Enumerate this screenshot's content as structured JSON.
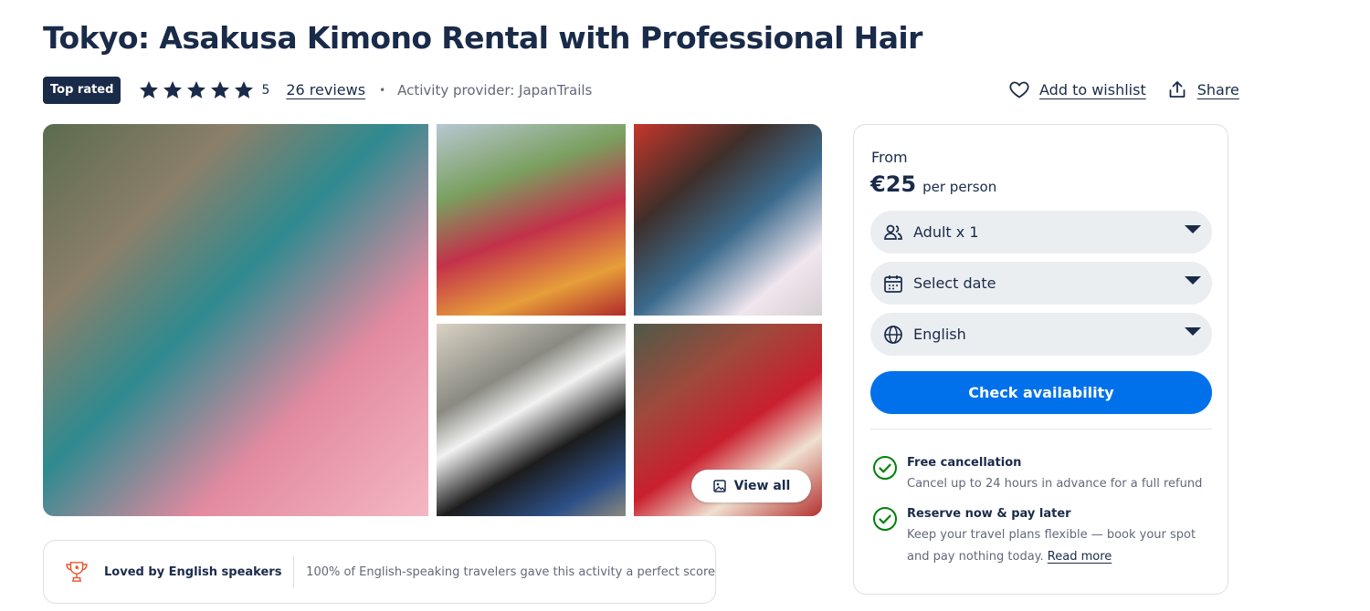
{
  "title": "Tokyo: Asakusa Kimono Rental with Professional Hair",
  "meta": {
    "badge": "Top rated",
    "stars": 5,
    "rating": "5",
    "reviews": "26 reviews",
    "separator": "•",
    "provider": "Activity provider: JapanTrails"
  },
  "actions": {
    "wishlist": "Add to wishlist",
    "share": "Share"
  },
  "gallery": {
    "view_all": "View all"
  },
  "loved": {
    "title": "Loved by English speakers",
    "text": "100% of English-speaking travelers gave this activity a perfect score"
  },
  "booking": {
    "from_label": "From",
    "price": "€25",
    "per": "per person",
    "participants": "Adult x 1",
    "date": "Select date",
    "language": "English",
    "cta": "Check availability"
  },
  "features": [
    {
      "title": "Free cancellation",
      "desc": "Cancel up to 24 hours in advance for a full refund"
    },
    {
      "title": "Reserve now & pay later",
      "desc": "Keep your travel plans flexible — book your spot and pay nothing today.",
      "link": "Read more"
    }
  ],
  "colors": {
    "navy": "#1a2b49",
    "primary": "#0071eb",
    "success": "#008009",
    "accent_orange": "#e8582d"
  }
}
